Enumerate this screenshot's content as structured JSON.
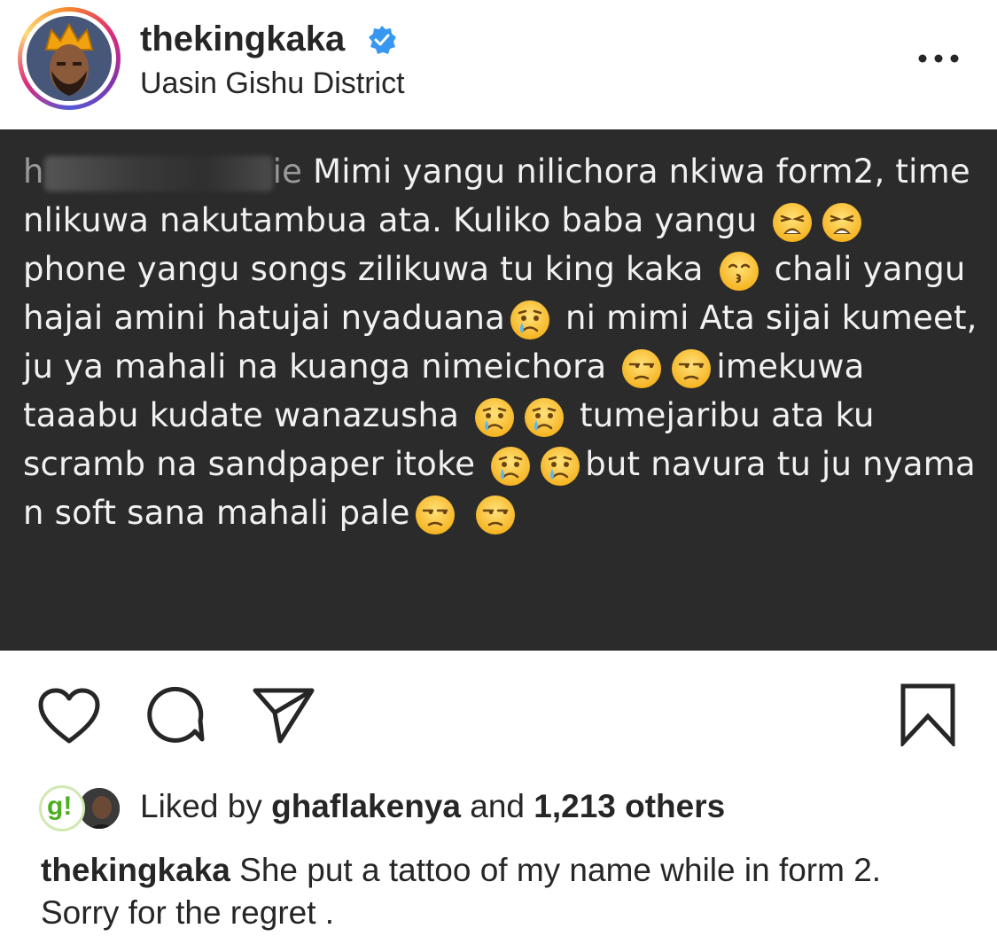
{
  "post": {
    "username": "thekingkaka",
    "location": "Uasin Gishu District"
  },
  "comment": {
    "blurred_handle_start": "h",
    "blurred_handle_end": "ie",
    "seg1": "Mimi yangu nilichora nkiwa form2, time nlikuwa nakutambua ata. Kuliko baba yangu",
    "seg2": "phone yangu songs zilikuwa tu king kaka",
    "seg3": "chali yangu hajai amini hatujai nyaduana",
    "seg4": "ni mimi Ata sijai kumeet, ju ya mahali na kuanga nimeichora",
    "seg5": "imekuwa taaabu kudate wanazusha",
    "seg6": "tumejaribu ata ku scramb na sandpaper itoke",
    "seg7": "but navura tu ju nyama n soft sana mahali pale"
  },
  "likes": {
    "prefix": "Liked by",
    "user": "ghaflakenya",
    "and": "and",
    "count": "1,213 others",
    "avatar_letter": "g!"
  },
  "caption": {
    "username": "thekingkaka",
    "text": "She put a tattoo of my name while in form 2. Sorry for the regret ."
  },
  "icons": {
    "like": "heart-icon",
    "comment": "comment-bubble-icon",
    "share": "paper-plane-icon",
    "save": "bookmark-icon",
    "more": "ellipsis-icon",
    "verified": "verified-badge-icon"
  },
  "colors": {
    "verified_blue": "#3897f0",
    "post_bg": "#2b2b2b",
    "text": "#262626"
  }
}
